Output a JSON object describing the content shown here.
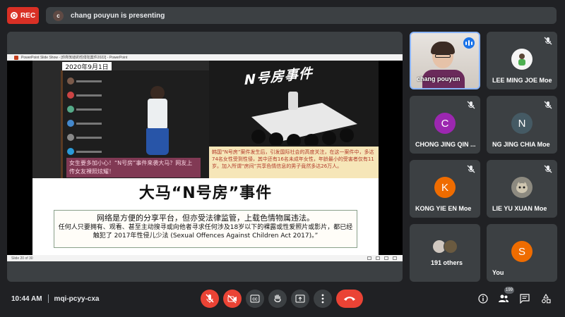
{
  "recording": {
    "label": "REC",
    "color": "#d93025"
  },
  "presenting": {
    "avatar_letter": "c",
    "text": "chang pouyun is presenting"
  },
  "slide_window": {
    "title": "PowerPoint Slide Show - [你所知道的性侵犯案件2022] - PowerPoint",
    "status": "Slide 20 of 30"
  },
  "slide": {
    "date": "2020年9月1日",
    "n_room_title": "N号房事件",
    "pink_caption": "女生要多加小心！“N号房”事件来袭大马？网友上传女友裸照炫耀！",
    "beige_text": "韩国“N号房”案件发生后，引发国际社会的高度关注，在这一案件中，多达74名女性受到性侵，其中还有16名未成年女性，年龄最小的受害者仅有11岁。加入所谓“房间”共享色情信息的男子竟然多达26万人。",
    "headline": "大马“N号房”事件",
    "body_line1": "网络是方便的分享平台，但亦受法律监管，上载色情物属违法。",
    "body_line2": "任何人只要拥有、观看、甚至主动搜寻或向他者寻求任何涉及18岁以下的裸露或性爱照片或影片，都已经触犯了 2017年性侵儿少法 (Sexual Offences Against Children Act 2017)。”"
  },
  "participants": [
    {
      "name": "chang pouyun",
      "type": "video",
      "speaking": true
    },
    {
      "name": "LEE MING JOE Moe",
      "type": "avatar-image",
      "muted": true
    },
    {
      "name": "CHONG JING QIN ...",
      "letter": "C",
      "color": "#9c27b0",
      "muted": true
    },
    {
      "name": "NG JING CHIA Moe",
      "letter": "N",
      "color": "#455a64",
      "muted": true
    },
    {
      "name": "KONG YIE EN Moe",
      "letter": "K",
      "color": "#ef6c00",
      "muted": true
    },
    {
      "name": "LIE YU XUAN Moe",
      "type": "avatar-image",
      "muted": true
    },
    {
      "name": "191 others",
      "type": "others"
    },
    {
      "name": "You",
      "letter": "S",
      "color": "#ef6c00",
      "muted": true
    }
  ],
  "meeting": {
    "time": "10:44 AM",
    "code": "mqi-pcyy-cxa",
    "participant_count": "199"
  },
  "controls": {
    "mic": "mic-off-icon",
    "camera": "camera-off-icon",
    "captions": "captions-icon",
    "raise_hand": "raise-hand-icon",
    "present": "present-screen-icon",
    "more": "more-options-icon",
    "end": "end-call-icon"
  }
}
